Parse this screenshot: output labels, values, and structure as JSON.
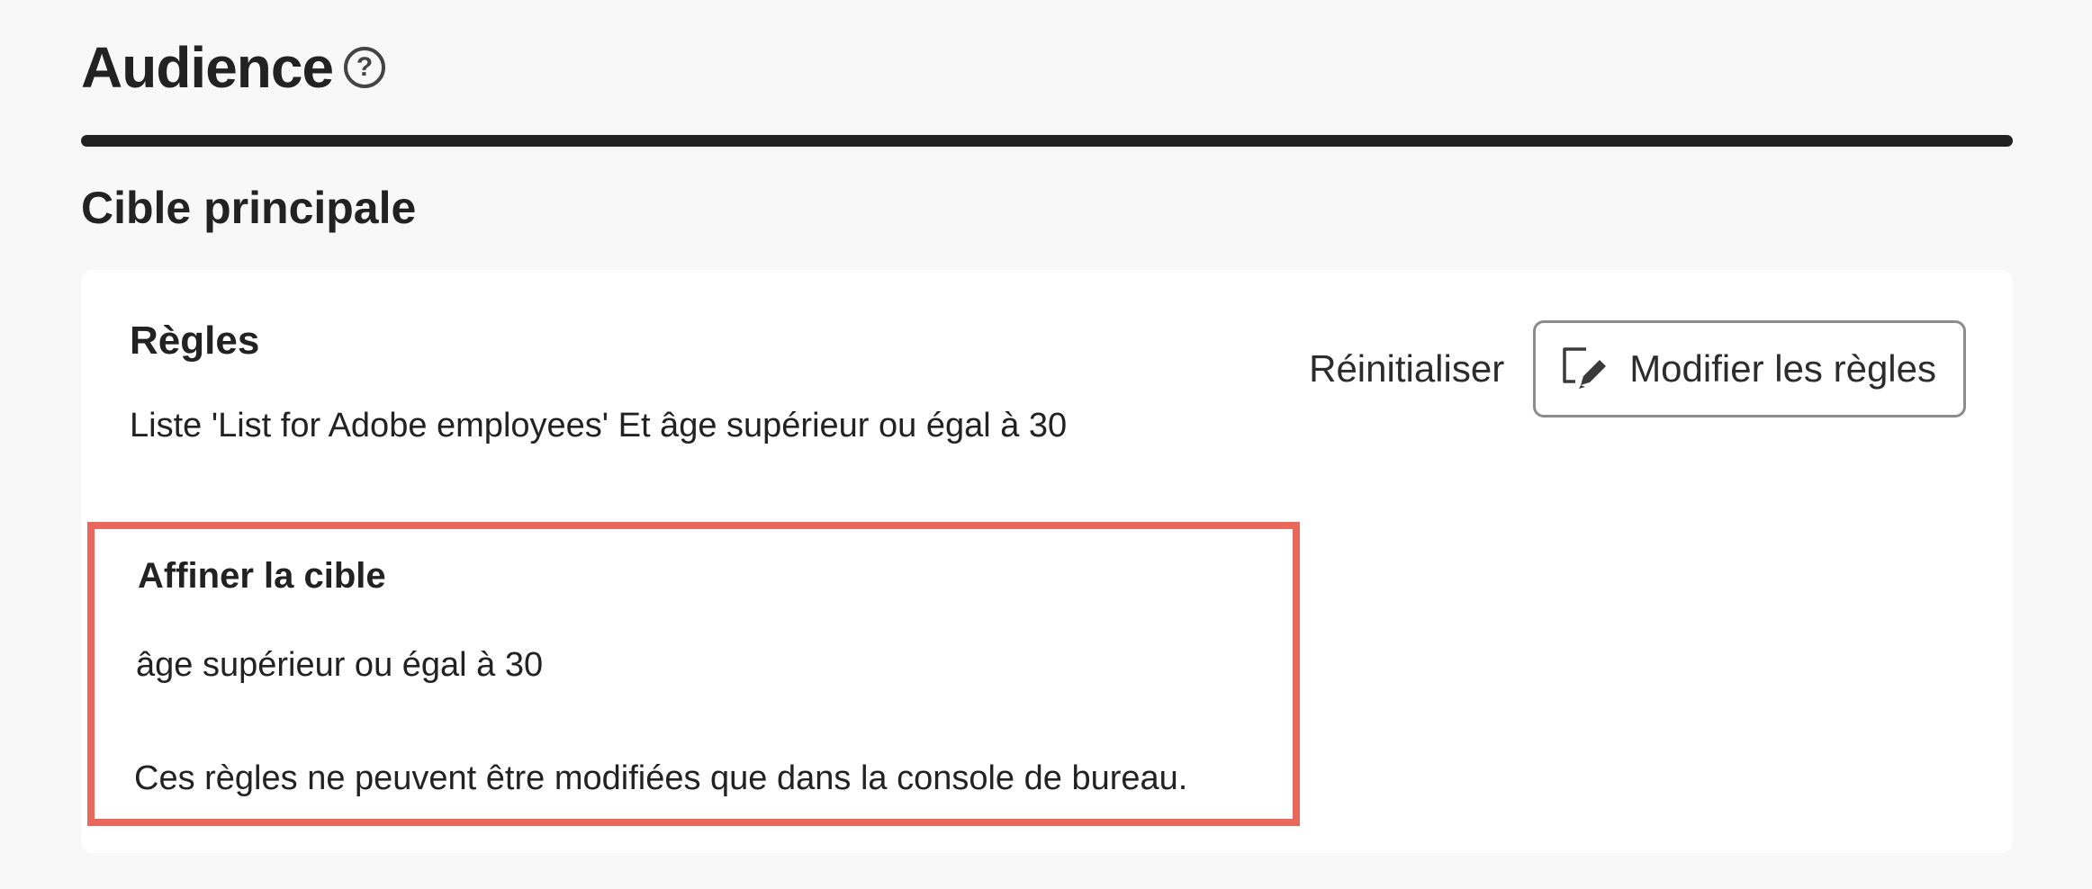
{
  "header": {
    "title": "Audience",
    "help_icon": "help-circle-icon",
    "help_glyph": "?"
  },
  "main_target": {
    "title": "Cible principale",
    "rules": {
      "title": "Règles",
      "description": "Liste 'List for Adobe employees' Et âge supérieur ou égal à 30"
    },
    "actions": {
      "reset_label": "Réinitialiser",
      "modify_label": "Modifier les règles",
      "modify_icon": "edit-icon"
    },
    "refine": {
      "title": "Affiner la cible",
      "rule": "âge supérieur ou égal à 30",
      "note": "Ces règles ne peuvent être modifiées que dans la console de bureau.",
      "highlight_color": "#e8685c"
    }
  }
}
